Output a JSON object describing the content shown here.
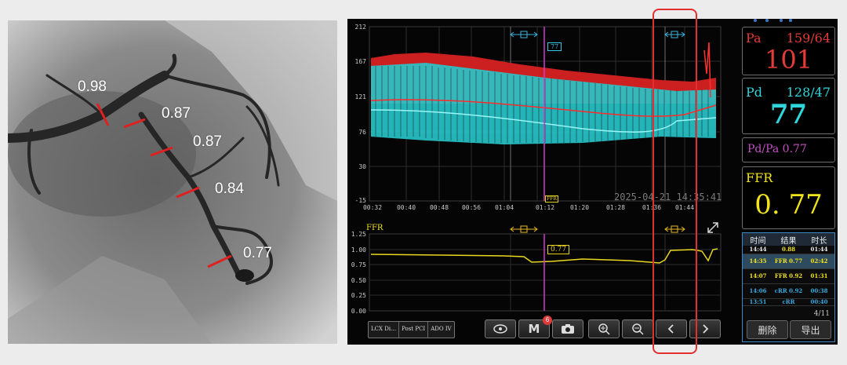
{
  "angio": {
    "labels": [
      "0.98",
      "0.87",
      "0.87",
      "0.84",
      "0.77"
    ]
  },
  "trend": {
    "y_ticks": [
      "212",
      "167",
      "121",
      "76",
      "30",
      "-15"
    ],
    "x_ticks": [
      "00:32",
      "00:40",
      "00:48",
      "00:56",
      "01:04",
      "01:12",
      "01:20",
      "01:28",
      "01:36",
      "01:44"
    ],
    "cursor_value": "77",
    "cursor_tag": "FFR",
    "timestamp": "2025-04-21 14:35:41"
  },
  "ffr_chart": {
    "label": "FFR",
    "y_ticks": [
      "1.25",
      "1.00",
      "0.75",
      "0.50",
      "0.25",
      "0.00"
    ],
    "cursor_value": "0.77"
  },
  "toolbar": {
    "tags": [
      "LCX Di…",
      "Post PCI",
      "ADO IV"
    ],
    "m_label": "M",
    "m_badge": "6"
  },
  "pa": {
    "label": "Pa",
    "sys_dia": "159/64",
    "mean": "101"
  },
  "pd": {
    "label": "Pd",
    "sys_dia": "128/47",
    "mean": "77"
  },
  "ratio": {
    "label": "Pd/Pa 0.77"
  },
  "ffr": {
    "label": "FFR",
    "value": "0. 77"
  },
  "table": {
    "headers": [
      "时间",
      "结果",
      "时长"
    ],
    "rows": [
      {
        "time": "14:44",
        "result": "0.88",
        "dur": "01:44"
      },
      {
        "time": "14:35",
        "result": "FFR 0.77",
        "dur": "02:42"
      },
      {
        "time": "14:07",
        "result": "FFR 0.92",
        "dur": "01:31"
      },
      {
        "time": "14:06",
        "result": "cRR 0.92",
        "dur": "00:38"
      },
      {
        "time": "13:51",
        "result": "cRR",
        "dur": "00:40"
      }
    ],
    "page": "4/11",
    "delete_label": "删除",
    "export_label": "导出"
  },
  "colors": {
    "pa": "#e53b36",
    "pd": "#2fd6db",
    "ratio": "#c44fc4",
    "ffr": "#f2e41c",
    "highlight": "#e23030"
  }
}
